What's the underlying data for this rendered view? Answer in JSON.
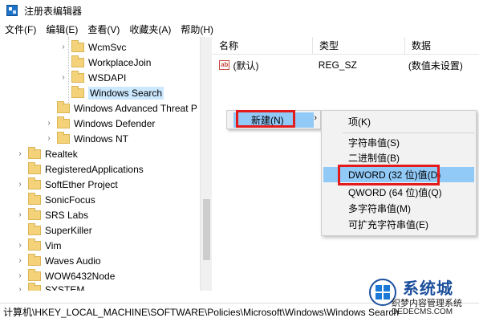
{
  "window": {
    "title": "注册表编辑器"
  },
  "menu": [
    "文件(F)",
    "编辑(E)",
    "查看(V)",
    "收藏夹(A)",
    "帮助(H)"
  ],
  "tree": [
    {
      "label": "WcmSvc",
      "expand": "›",
      "selected": false
    },
    {
      "label": "WorkplaceJoin",
      "expand": "",
      "selected": false
    },
    {
      "label": "WSDAPI",
      "expand": "›",
      "selected": false
    },
    {
      "label": "Windows Search",
      "expand": "",
      "selected": true
    },
    {
      "label": "Windows Advanced Threat P",
      "expand": "",
      "selected": false
    },
    {
      "label": "Windows Defender",
      "expand": "›",
      "selected": false
    },
    {
      "label": "Windows NT",
      "expand": "›",
      "selected": false
    },
    {
      "label": "Realtek",
      "expand": "›",
      "selected": false
    },
    {
      "label": "RegisteredApplications",
      "expand": "",
      "selected": false
    },
    {
      "label": "SoftEther Project",
      "expand": "›",
      "selected": false
    },
    {
      "label": "SonicFocus",
      "expand": "",
      "selected": false
    },
    {
      "label": "SRS Labs",
      "expand": "›",
      "selected": false
    },
    {
      "label": "SuperKiller",
      "expand": "",
      "selected": false
    },
    {
      "label": "Vim",
      "expand": "›",
      "selected": false
    },
    {
      "label": "Waves Audio",
      "expand": "›",
      "selected": false
    },
    {
      "label": "WOW6432Node",
      "expand": "›",
      "selected": false
    },
    {
      "label": "SYSTEM",
      "expand": "›",
      "selected": false
    }
  ],
  "list": {
    "columns": [
      "名称",
      "类型",
      "数据"
    ],
    "rows": [
      {
        "name": "(默认)",
        "type": "REG_SZ",
        "data": "(数值未设置)"
      }
    ]
  },
  "context_menu": {
    "new_label": "新建(N)",
    "arrow": "›"
  },
  "submenu": {
    "items": [
      "项(K)",
      "字符串值(S)",
      "二进制值(B)",
      "DWORD (32 位)值(D)",
      "QWORD (64 位)值(Q)",
      "多字符串值(M)",
      "可扩充字符串值(E)"
    ],
    "highlight_index": 3
  },
  "status": {
    "path": "计算机\\HKEY_LOCAL_MACHINE\\SOFTWARE\\Policies\\Microsoft\\Windows\\Windows Search"
  },
  "watermark": {
    "brand": "系统城",
    "line1": "织梦内容管理系统",
    "line2": "DEDECMS.COM",
    "site": "xitongcheng.com"
  },
  "colors": {
    "selection": "#91c9f7",
    "annotation": "#e31b1b",
    "folder": "#f3d27a"
  }
}
